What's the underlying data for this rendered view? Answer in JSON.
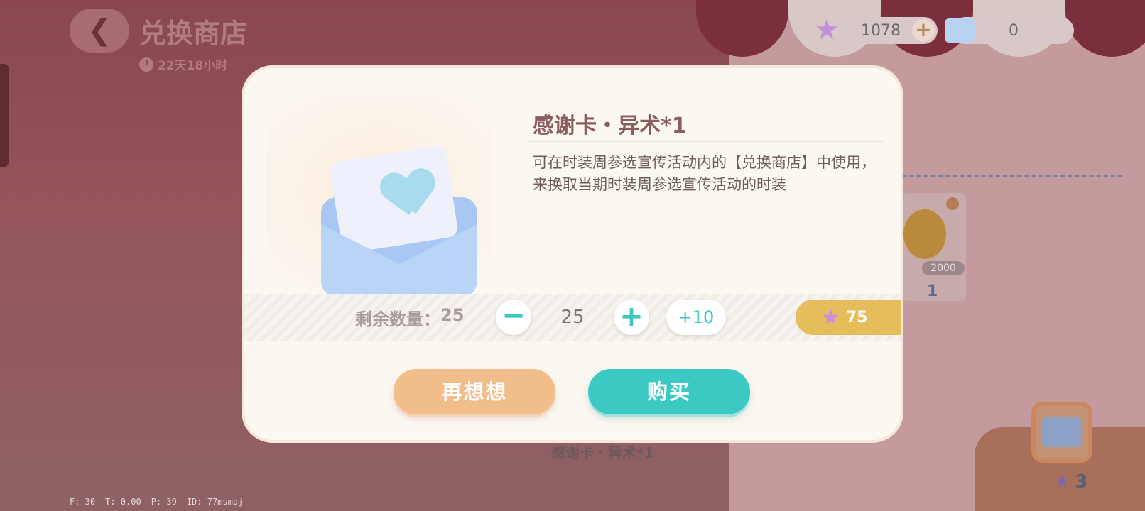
{
  "header": {
    "title": "兑换商店",
    "timer": "22天18小时"
  },
  "currency": {
    "stars": "1078",
    "cards": "0"
  },
  "background": {
    "card_price": "2000",
    "card_count": "1",
    "bottom_count": "3",
    "below_label": "感谢卡・异术*1"
  },
  "debug": {
    "f": "F: 30",
    "t": "T: 0.00",
    "p": "P: 39",
    "id": "ID: 77msmqj"
  },
  "modal": {
    "item_name": "感谢卡・异术*1",
    "description": "可在时装周参选宣传活动内的【兑换商店】中使用，来换取当期时装周参选宣传活动的时装",
    "remaining_label": "剩余数量：",
    "remaining_value": "25",
    "quantity": "25",
    "plus10_label": "+10",
    "price": "75",
    "cancel_label": "再想想",
    "buy_label": "购买"
  },
  "colors": {
    "buy": "#3dc9c3",
    "cancel": "#f0bd8b",
    "price": "#e6bd5b"
  },
  "icons": [
    "back-arrow-icon",
    "clock-icon",
    "star-icon",
    "envelope-card-icon",
    "minus-icon",
    "plus-icon"
  ]
}
